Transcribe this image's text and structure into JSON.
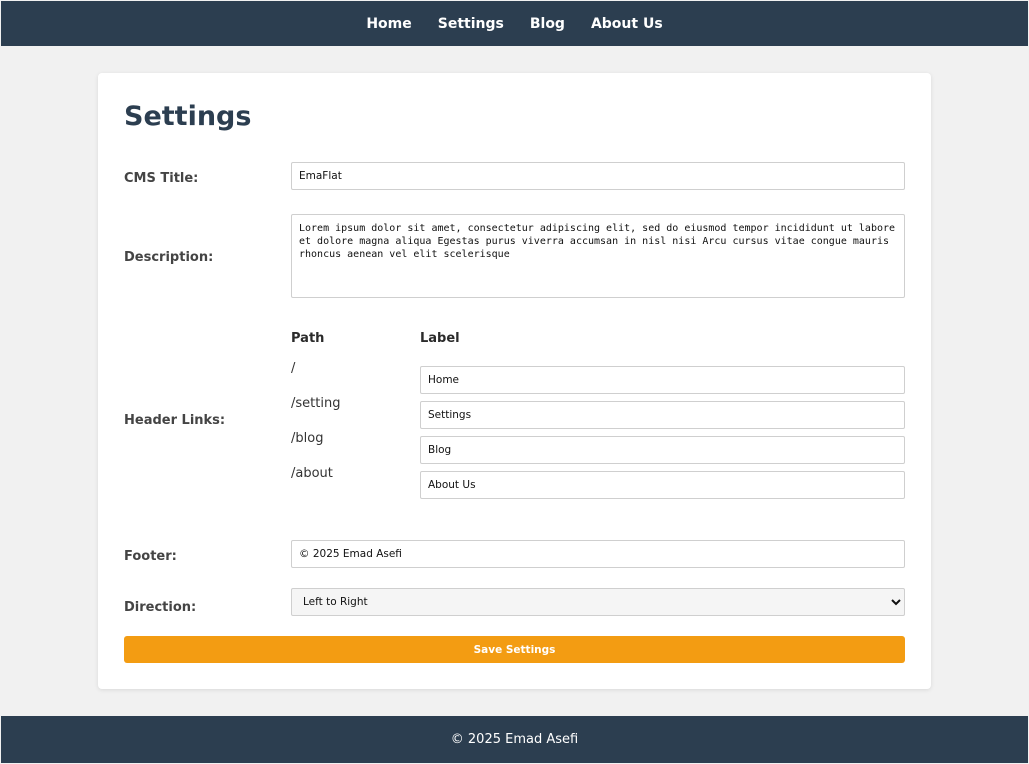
{
  "nav": {
    "items": [
      {
        "label": "Home"
      },
      {
        "label": "Settings"
      },
      {
        "label": "Blog"
      },
      {
        "label": "About Us"
      }
    ]
  },
  "page": {
    "title": "Settings"
  },
  "form": {
    "cms_title": {
      "label": "CMS Title:",
      "value": "EmaFlat"
    },
    "description": {
      "label": "Description:",
      "value": "Lorem ipsum dolor sit amet, consectetur adipiscing elit, sed do eiusmod tempor incididunt ut labore et dolore magna aliqua Egestas purus viverra accumsan in nisl nisi Arcu cursus vitae congue mauris rhoncus aenean vel elit scelerisque"
    },
    "header_links": {
      "label": "Header Links:",
      "path_header": "Path",
      "label_header": "Label",
      "rows": [
        {
          "path": "/",
          "label": "Home"
        },
        {
          "path": "/setting",
          "label": "Settings"
        },
        {
          "path": "/blog",
          "label": "Blog"
        },
        {
          "path": "/about",
          "label": "About Us"
        }
      ]
    },
    "footer": {
      "label": "Footer:",
      "value": "© 2025 Emad Asefi"
    },
    "direction": {
      "label": "Direction:",
      "selected": "Left to Right"
    },
    "save_label": "Save Settings"
  },
  "footer": {
    "text": "© 2025 Emad Asefi"
  },
  "colors": {
    "header_bg": "#2c3e50",
    "accent": "#f39c12"
  }
}
